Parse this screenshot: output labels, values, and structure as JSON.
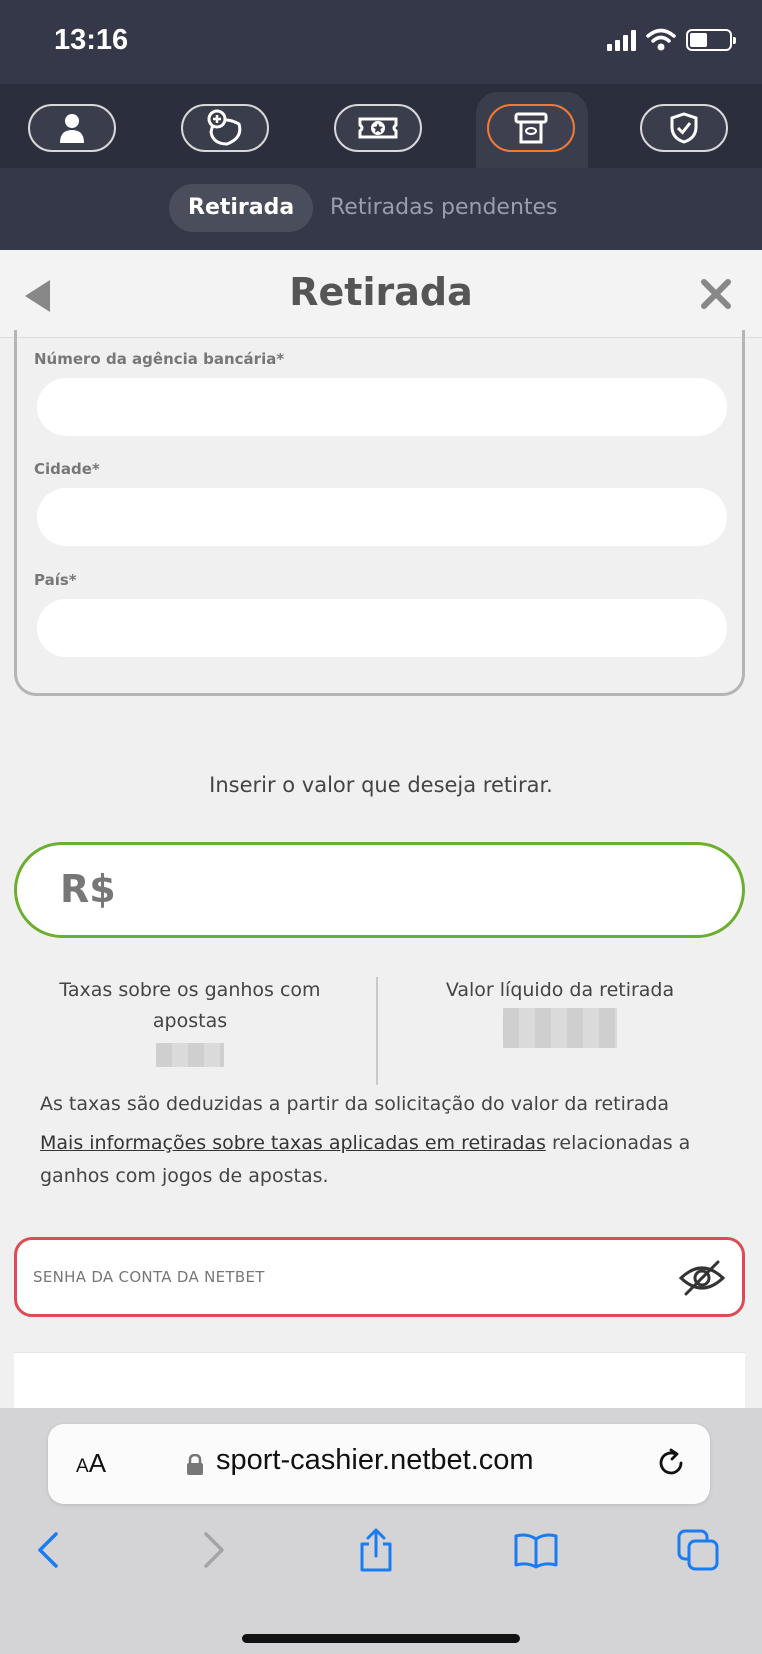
{
  "status_bar": {
    "time": "13:16"
  },
  "tabs": {
    "active": "Retirada",
    "pending": "Retiradas pendentes"
  },
  "header": {
    "title": "Retirada"
  },
  "form": {
    "agency_label": "Número da agência bancária*",
    "city_label": "Cidade*",
    "country_label": "País*"
  },
  "amount": {
    "instruction": "Inserir o valor que deseja retirar.",
    "currency": "R$"
  },
  "fees": {
    "tax_label": "Taxas sobre os ganhos com apostas",
    "net_label": "Valor líquido da retirada",
    "deduction_note": "As taxas são deduzidas a partir da solicitação do valor da retirada",
    "more_info_link": "Mais informações sobre taxas aplicadas em retiradas",
    "more_info_rest": " relacionadas a ganhos com jogos de apostas."
  },
  "password": {
    "placeholder": "SENHA DA CONTA DA NETBET"
  },
  "browser": {
    "aa_small": "A",
    "aa_large": "A",
    "url": "sport-cashier.netbet.com"
  },
  "colors": {
    "accent_orange": "#f07a36",
    "amount_border": "#6cae2e",
    "password_border": "#e04a55"
  }
}
